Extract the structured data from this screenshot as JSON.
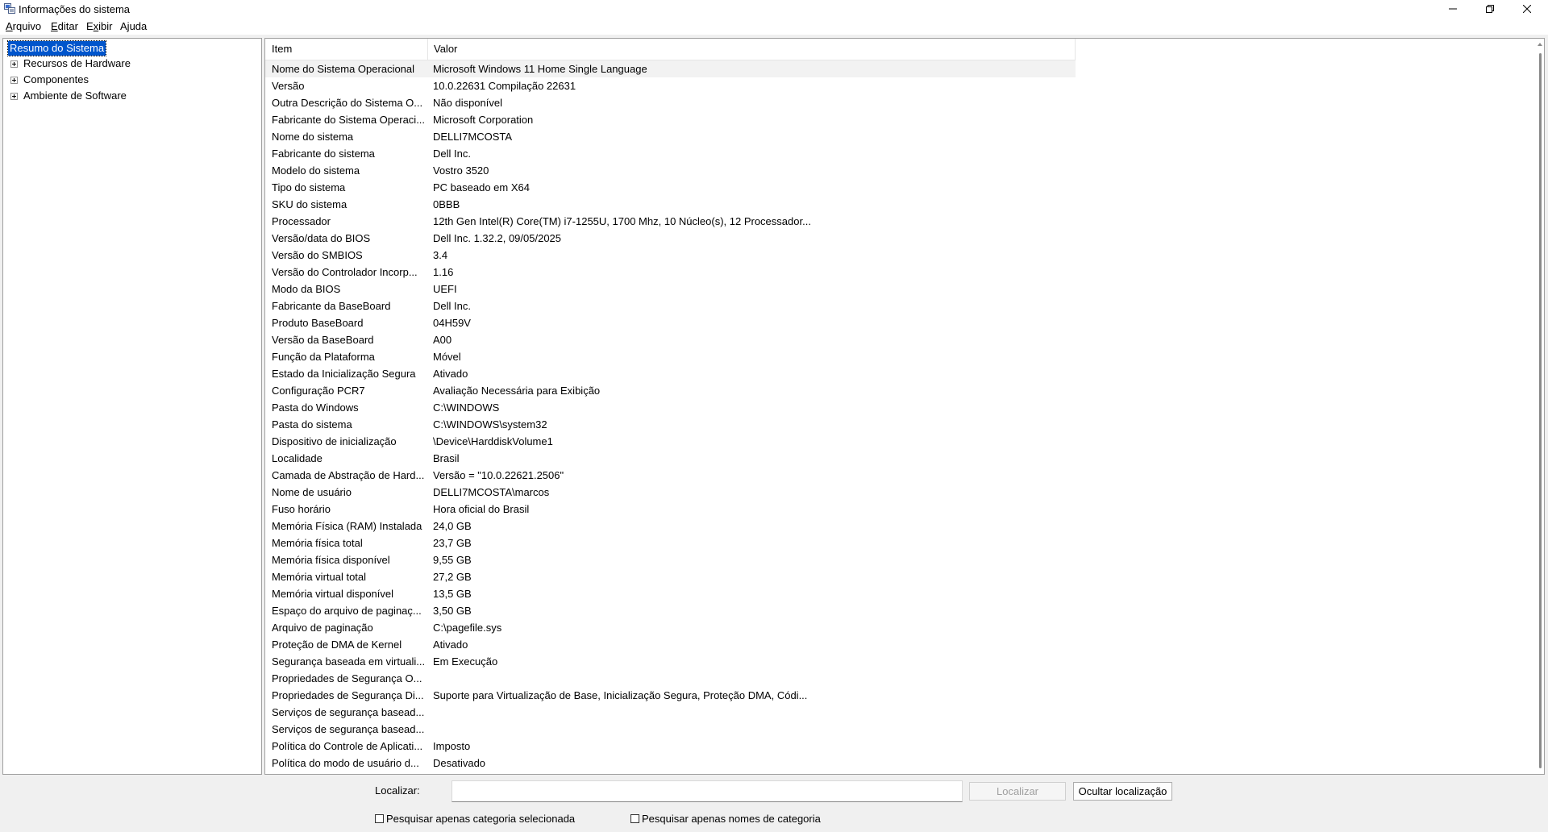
{
  "window": {
    "title": "Informações do sistema"
  },
  "menu": [
    {
      "label": "Arquivo",
      "underline": "A",
      "rest": "rquivo"
    },
    {
      "label": "Editar",
      "underline": "E",
      "rest": "ditar"
    },
    {
      "label": "Exibir",
      "underline": "x",
      "rest": "ibir",
      "prefix": "E"
    },
    {
      "label": "Ajuda",
      "underline": "j",
      "rest": "uda",
      "prefix": "A"
    }
  ],
  "tree": {
    "root": "Resumo do Sistema",
    "children": [
      "Recursos de Hardware",
      "Componentes",
      "Ambiente de Software"
    ]
  },
  "list": {
    "columns": [
      "Item",
      "Valor"
    ],
    "rows": [
      [
        "Nome do Sistema Operacional",
        "Microsoft Windows 11 Home Single Language"
      ],
      [
        "Versão",
        "10.0.22631 Compilação 22631"
      ],
      [
        "Outra Descrição do Sistema O...",
        "Não disponível"
      ],
      [
        "Fabricante do Sistema Operaci...",
        "Microsoft Corporation"
      ],
      [
        "Nome do sistema",
        "DELLI7MCOSTA"
      ],
      [
        "Fabricante do sistema",
        "Dell Inc."
      ],
      [
        "Modelo do sistema",
        "Vostro 3520"
      ],
      [
        "Tipo do sistema",
        "PC baseado em X64"
      ],
      [
        "SKU do sistema",
        "0BBB"
      ],
      [
        "Processador",
        "12th Gen Intel(R) Core(TM) i7-1255U, 1700 Mhz, 10 Núcleo(s), 12 Processador..."
      ],
      [
        "Versão/data do BIOS",
        "Dell Inc. 1.32.2, 09/05/2025"
      ],
      [
        "Versão do SMBIOS",
        "3.4"
      ],
      [
        "Versão do Controlador Incorp...",
        "1.16"
      ],
      [
        "Modo da BIOS",
        "UEFI"
      ],
      [
        "Fabricante da BaseBoard",
        "Dell Inc."
      ],
      [
        "Produto BaseBoard",
        "04H59V"
      ],
      [
        "Versão da BaseBoard",
        "A00"
      ],
      [
        "Função da Plataforma",
        "Móvel"
      ],
      [
        "Estado da Inicialização Segura",
        "Ativado"
      ],
      [
        "Configuração PCR7",
        "Avaliação Necessária para Exibição"
      ],
      [
        "Pasta do Windows",
        "C:\\WINDOWS"
      ],
      [
        "Pasta do sistema",
        "C:\\WINDOWS\\system32"
      ],
      [
        "Dispositivo de inicialização",
        "\\Device\\HarddiskVolume1"
      ],
      [
        "Localidade",
        "Brasil"
      ],
      [
        "Camada de Abstração de Hard...",
        "Versão = \"10.0.22621.2506\""
      ],
      [
        "Nome de usuário",
        "DELLI7MCOSTA\\marcos"
      ],
      [
        "Fuso horário",
        "Hora oficial do Brasil"
      ],
      [
        "Memória Física (RAM) Instalada",
        "24,0 GB"
      ],
      [
        "Memória física total",
        "23,7 GB"
      ],
      [
        "Memória física disponível",
        "9,55 GB"
      ],
      [
        "Memória virtual total",
        "27,2 GB"
      ],
      [
        "Memória virtual disponível",
        "13,5 GB"
      ],
      [
        "Espaço do arquivo de paginaç...",
        "3,50 GB"
      ],
      [
        "Arquivo de paginação",
        "C:\\pagefile.sys"
      ],
      [
        "Proteção de DMA de Kernel",
        "Ativado"
      ],
      [
        "Segurança baseada em virtuali...",
        "Em Execução"
      ],
      [
        "Propriedades de Segurança O...",
        ""
      ],
      [
        "Propriedades de Segurança Di...",
        "Suporte para Virtualização de Base, Inicialização Segura, Proteção DMA, Códi..."
      ],
      [
        "Serviços de segurança basead...",
        ""
      ],
      [
        "Serviços de segurança basead...",
        ""
      ],
      [
        "Política do Controle de Aplicati...",
        "Imposto"
      ],
      [
        "Política do modo de usuário d...",
        "Desativado"
      ]
    ]
  },
  "find": {
    "label": "Localizar:",
    "value": "",
    "find_button": "Localizar",
    "hide_button": "Ocultar localização",
    "checkbox_selected_category": "Pesquisar apenas categoria selecionada",
    "checkbox_category_names": "Pesquisar apenas nomes de categoria"
  }
}
